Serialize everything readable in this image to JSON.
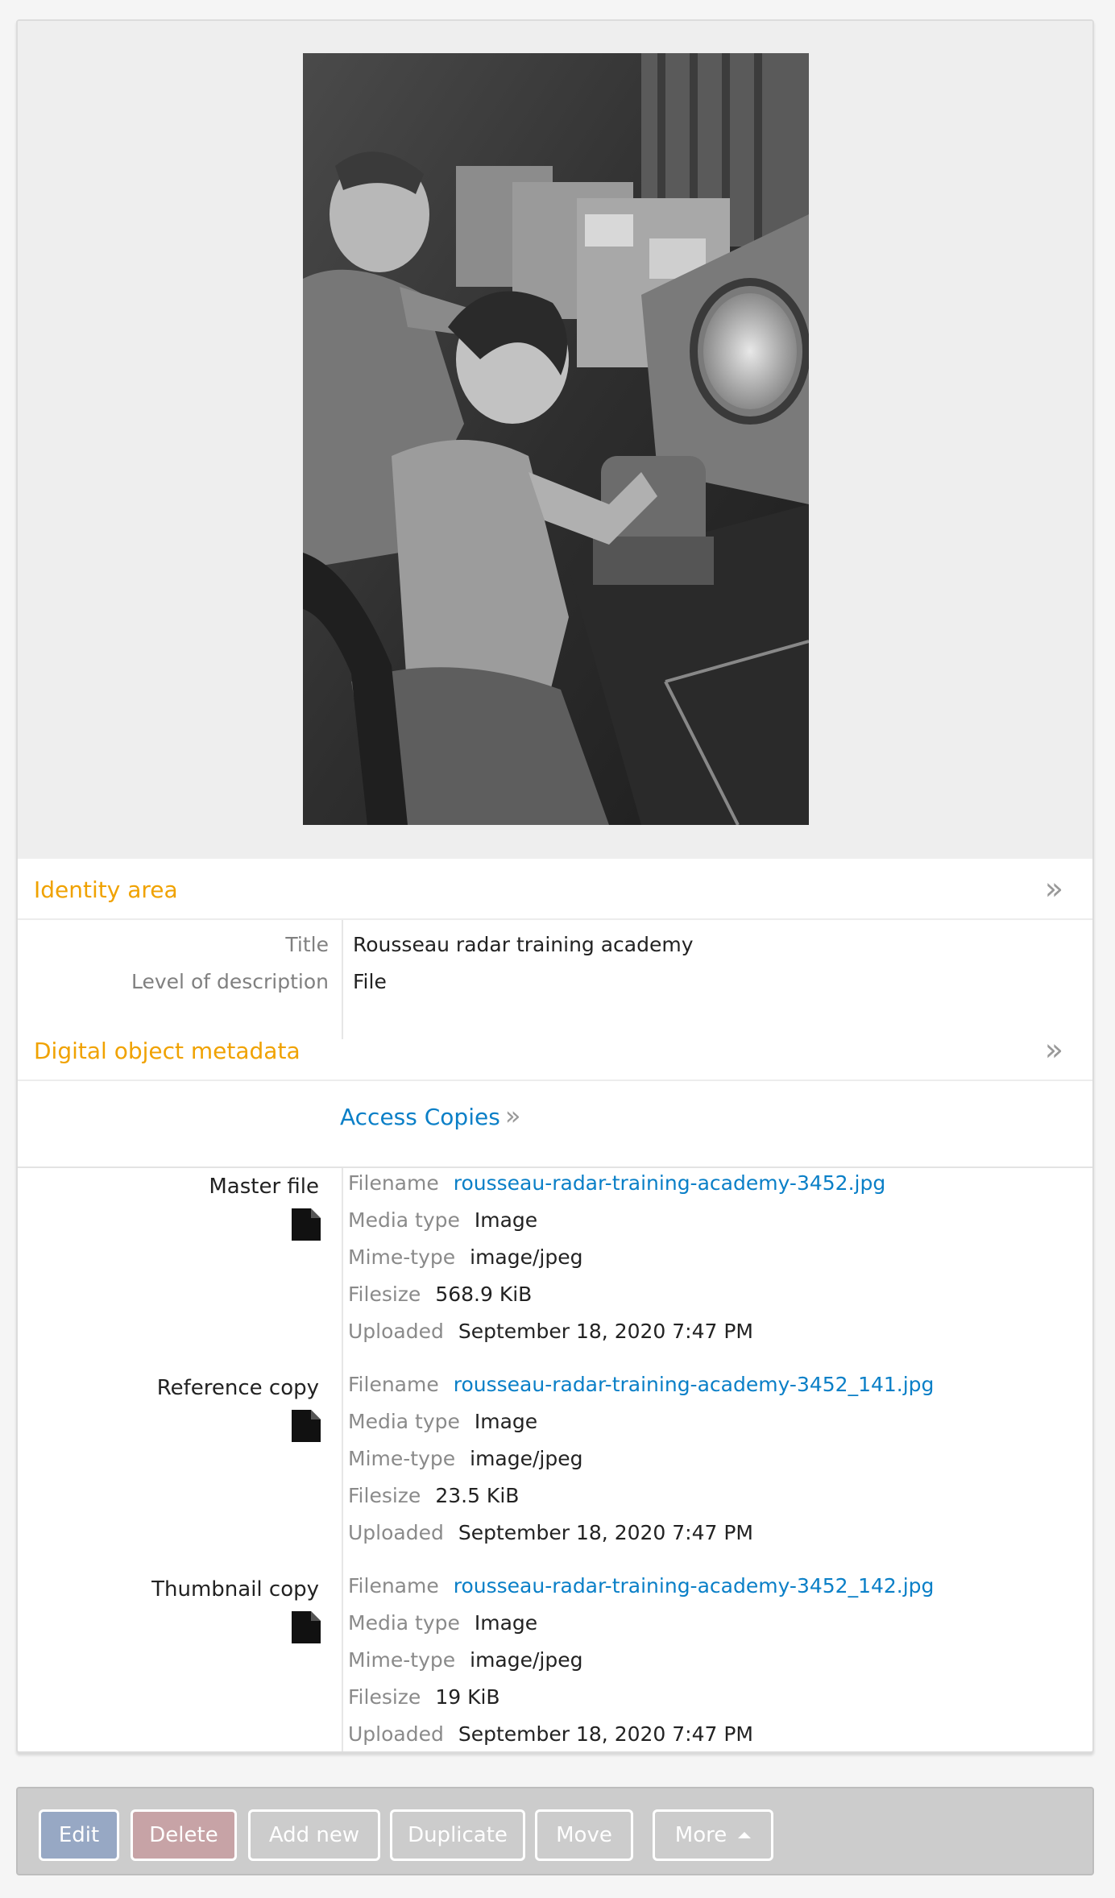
{
  "identity": {
    "header": "Identity area",
    "fields": [
      {
        "label": "Title",
        "value": "Rousseau radar training academy"
      },
      {
        "label": "Level of description",
        "value": "File"
      }
    ]
  },
  "digital_object": {
    "header": "Digital object metadata",
    "access_copies_label": "Access Copies",
    "files": [
      {
        "type": "Master file",
        "filename_label": "Filename",
        "filename": "rousseau-radar-training-academy-3452.jpg",
        "media_type_label": "Media type",
        "media_type": "Image",
        "mime_label": "Mime-type",
        "mime": "image/jpeg",
        "size_label": "Filesize",
        "size": "568.9 KiB",
        "uploaded_label": "Uploaded",
        "uploaded": "September 18, 2020 7:47 PM"
      },
      {
        "type": "Reference copy",
        "filename_label": "Filename",
        "filename": "rousseau-radar-training-academy-3452_141.jpg",
        "media_type_label": "Media type",
        "media_type": "Image",
        "mime_label": "Mime-type",
        "mime": "image/jpeg",
        "size_label": "Filesize",
        "size": "23.5 KiB",
        "uploaded_label": "Uploaded",
        "uploaded": "September 18, 2020 7:47 PM"
      },
      {
        "type": "Thumbnail copy",
        "filename_label": "Filename",
        "filename": "rousseau-radar-training-academy-3452_142.jpg",
        "media_type_label": "Media type",
        "media_type": "Image",
        "mime_label": "Mime-type",
        "mime": "image/jpeg",
        "size_label": "Filesize",
        "size": "19 KiB",
        "uploaded_label": "Uploaded",
        "uploaded": "September 18, 2020 7:47 PM"
      }
    ]
  },
  "actions": {
    "edit": "Edit",
    "delete": "Delete",
    "add_new": "Add new",
    "duplicate": "Duplicate",
    "move": "Move",
    "more": "More"
  },
  "colors": {
    "section_header": "#f0a200",
    "link": "#0a7fc7",
    "edit_button": "#97a8c4",
    "delete_button": "#c7a3a6"
  },
  "icons": {
    "section_toggle": "double-chevron-right-icon",
    "file": "document-icon",
    "more_caret": "caret-up-icon"
  }
}
